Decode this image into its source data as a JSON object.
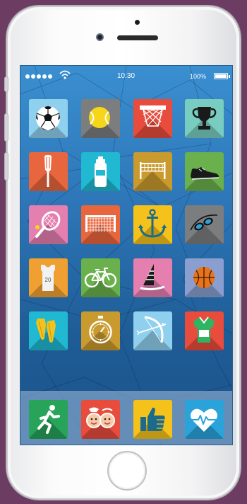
{
  "status_bar": {
    "time": "10:30",
    "battery": "100%"
  },
  "apps": [
    {
      "icon": "soccer-ball-icon",
      "color": "#8fd0ee"
    },
    {
      "icon": "tennis-ball-icon",
      "color": "#7c7d7f"
    },
    {
      "icon": "basketball-hoop-icon",
      "color": "#e84c3d"
    },
    {
      "icon": "trophy-icon",
      "color": "#79cdc0"
    },
    {
      "icon": "paddle-icon",
      "color": "#e8663d"
    },
    {
      "icon": "water-bottle-icon",
      "color": "#21b8d2"
    },
    {
      "icon": "volleyball-net-icon",
      "color": "#c99a2e"
    },
    {
      "icon": "sneaker-icon",
      "color": "#6ab04c"
    },
    {
      "icon": "tennis-racket-icon",
      "color": "#e57fb0"
    },
    {
      "icon": "soccer-goal-icon",
      "color": "#e8663d"
    },
    {
      "icon": "anchor-icon",
      "color": "#f5c21b"
    },
    {
      "icon": "swim-goggles-icon",
      "color": "#7c7d7f"
    },
    {
      "icon": "jersey-icon",
      "color": "#f0a030",
      "label": "20"
    },
    {
      "icon": "bicycle-icon",
      "color": "#6ab04c"
    },
    {
      "icon": "windsurf-sail-icon",
      "color": "#e57fb0"
    },
    {
      "icon": "basketball-icon",
      "color": "#8a9fd0"
    },
    {
      "icon": "swim-fins-icon",
      "color": "#21b8d2"
    },
    {
      "icon": "stopwatch-icon",
      "color": "#c99a2e"
    },
    {
      "icon": "bow-arrow-icon",
      "color": "#8fd0ee"
    },
    {
      "icon": "referee-shirt-icon",
      "color": "#e84c3d"
    }
  ],
  "dock": [
    {
      "icon": "runner-icon",
      "color": "#27a35a"
    },
    {
      "icon": "kids-faces-icon",
      "color": "#e84c3d"
    },
    {
      "icon": "thumbs-up-icon",
      "color": "#f5c21b"
    },
    {
      "icon": "heart-rate-icon",
      "color": "#2aa3db"
    }
  ]
}
